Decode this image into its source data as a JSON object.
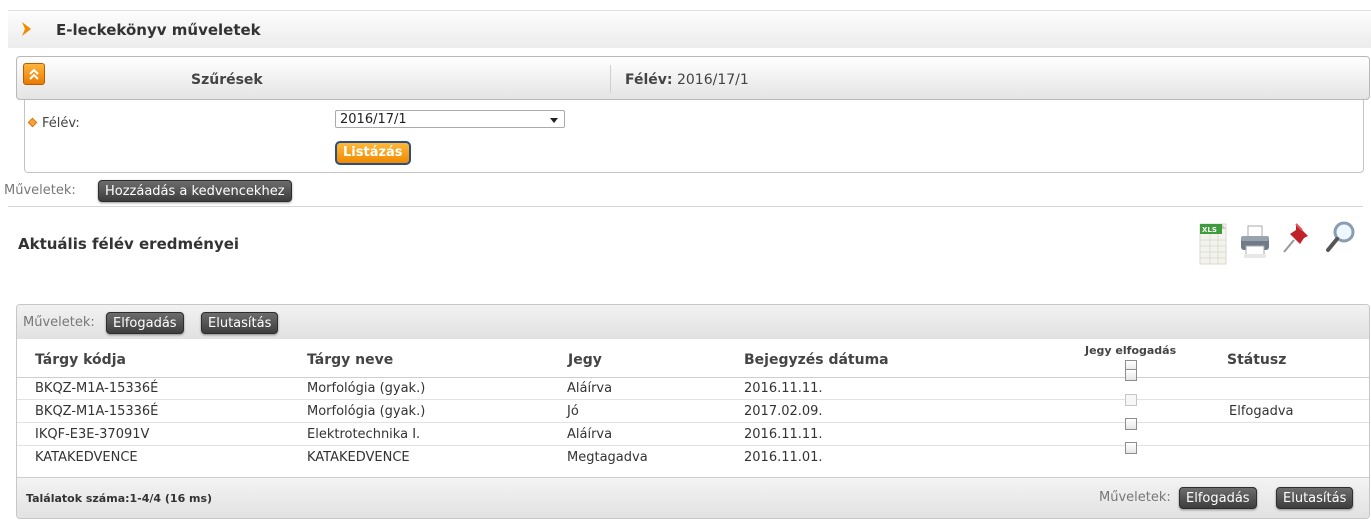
{
  "page": {
    "title": "E-leckekönyv műveletek"
  },
  "filter": {
    "title": "Szűrések",
    "summary_label": "Félév:",
    "summary_value": "2016/17/1",
    "field_label": "Félév:",
    "select_value": "2016/17/1",
    "list_button": "Listázás"
  },
  "operations": {
    "label": "Műveletek:",
    "favorites_button": "Hozzáadás a kedvencekhez"
  },
  "section": {
    "title": "Aktuális félév eredményei"
  },
  "toolbar_icons": [
    "excel-export-icon",
    "print-icon",
    "pin-icon",
    "search-magnifier-icon"
  ],
  "grid": {
    "ops_label": "Műveletek:",
    "accept_button": "Elfogadás",
    "reject_button": "Elutasítás",
    "columns": {
      "code": "Tárgy kódja",
      "name": "Tárgy neve",
      "grade": "Jegy",
      "date": "Bejegyzés dátuma",
      "accept": "Jegy elfogadás",
      "status": "Státusz"
    },
    "rows": [
      {
        "code": "BKQZ-M1A-15336É",
        "name": "Morfológia (gyak.)",
        "grade": "Aláírva",
        "date": "2016.11.11.",
        "checkbox_enabled": true,
        "status": ""
      },
      {
        "code": "BKQZ-M1A-15336É",
        "name": "Morfológia (gyak.)",
        "grade": "Jó",
        "date": "2017.02.09.",
        "checkbox_enabled": false,
        "status": "Elfogadva"
      },
      {
        "code": "IKQF-E3E-37091V",
        "name": "Elektrotechnika I.",
        "grade": "Aláírva",
        "date": "2016.11.11.",
        "checkbox_enabled": true,
        "status": ""
      },
      {
        "code": "KATAKEDVENCE",
        "name": "KATAKEDVENCE",
        "grade": "Megtagadva",
        "date": "2016.11.01.",
        "checkbox_enabled": true,
        "status": ""
      }
    ],
    "result_count": "Találatok száma:1-4/4 (16 ms)"
  },
  "colors": {
    "accent_orange": "#f08a00",
    "dark_button": "#4a4a4a"
  }
}
